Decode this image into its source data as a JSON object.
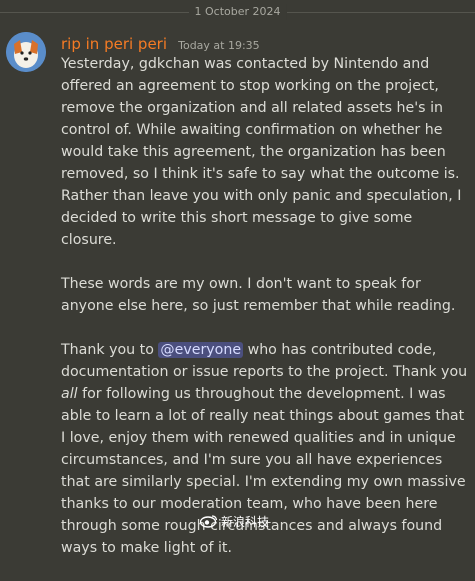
{
  "divider": {
    "date": "1 October 2024"
  },
  "message": {
    "username": "rip in peri peri",
    "timestamp": "Today at 19:35",
    "p1": "Yesterday, gdkchan was contacted by Nintendo and offered an agreement to stop working on the project, remove the organization and all related assets he's in control of. While awaiting confirmation on whether he would take this agreement, the organization has been removed, so I think it's safe to say what the outcome is. Rather than leave you with only panic and speculation, I decided to write this short message to give some closure.",
    "p2": "These words are my own. I don't want to speak for anyone else here, so just remember that while reading.",
    "p3_a": "Thank you to ",
    "mention": "@everyone",
    "p3_b": " who has contributed code, documentation or issue reports to the project. Thank you ",
    "p3_all": "all",
    "p3_c": " for following us throughout the development. I was able to learn a lot of really neat things about games that I love, enjoy them with renewed qualities and in unique circumstances, and I'm sure you all have experiences that are similarly special. I'm extending my own massive thanks to our moderation team, who have been here through some rough circumstances and always found ways to make light of it."
  },
  "watermark": {
    "text": "新浪科技",
    "icon": "weibo-eye-icon"
  },
  "colors": {
    "background": "#3b3b35",
    "username": "#f57b24",
    "mention_bg": "#4b4f7e"
  }
}
